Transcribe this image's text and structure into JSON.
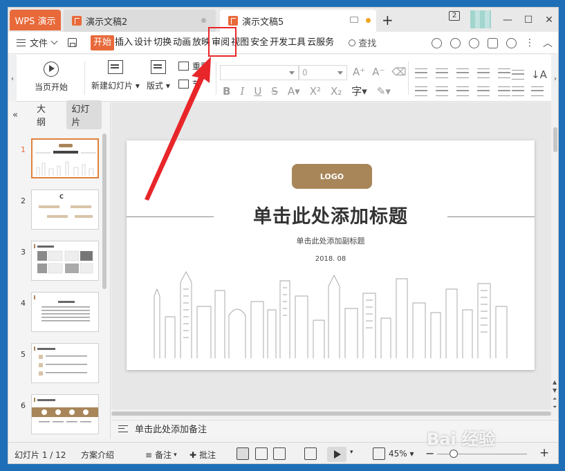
{
  "tabbar": {
    "app_name": "WPS 演示",
    "tabs": [
      {
        "label": "演示文稿2"
      },
      {
        "label": "演示文稿5"
      }
    ],
    "new_tab": "+",
    "window_count": "2"
  },
  "menubar": {
    "file": "文件",
    "tabs": [
      "开始",
      "插入",
      "设计",
      "切换",
      "动画",
      "放映",
      "审阅",
      "视图",
      "安全",
      "开发工具",
      "云服务"
    ],
    "active_tab": "开始",
    "search": "查找"
  },
  "ribbon": {
    "from_current": "当页开始",
    "new_slide": "新建幻灯片",
    "layout": "版式",
    "reset": "重置",
    "section": "节",
    "font_size": "0",
    "font_name": ""
  },
  "left_pane": {
    "collapse": "«",
    "tabs": [
      "大纲",
      "幻灯片"
    ],
    "active_tab": "幻灯片",
    "thumbs": [
      "1",
      "2",
      "3",
      "4",
      "5",
      "6"
    ]
  },
  "slide": {
    "logo": "LOGO",
    "title": "单击此处添加标题",
    "subtitle": "单击此处添加副标题",
    "date": "2018. 08"
  },
  "notes": {
    "placeholder": "单击此处添加备注"
  },
  "statusbar": {
    "slide_count": "幻灯片 1 / 12",
    "theme": "方案介绍",
    "notes": "备注",
    "comments": "批注",
    "zoom": "45%"
  },
  "watermark": "Bai 经验",
  "colors": {
    "accent": "#e8693a",
    "highlight": "#e8262a",
    "logo_brown": "#a8865a"
  }
}
